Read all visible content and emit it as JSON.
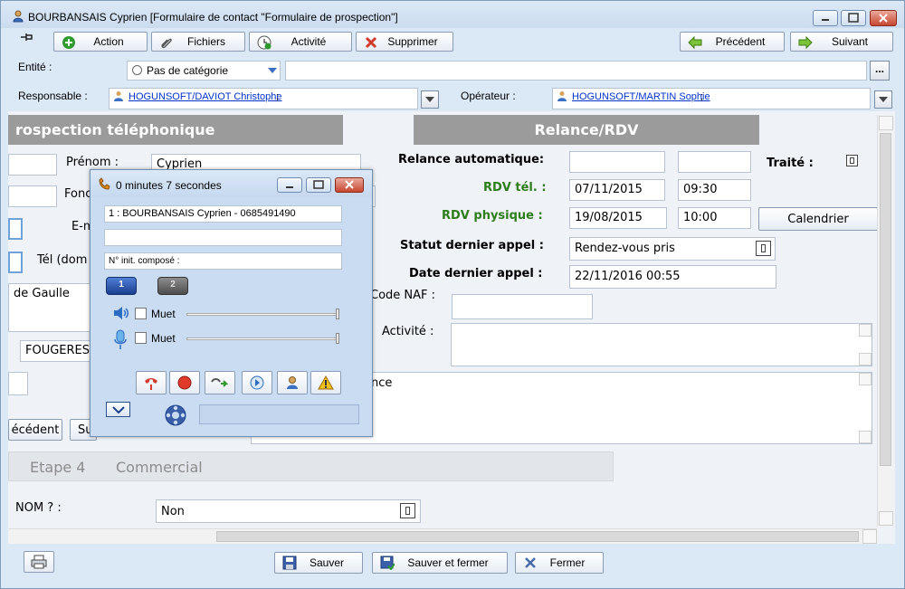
{
  "window": {
    "title": "BOURBANSAIS Cyprien [Formulaire de contact \"Formulaire de prospection\"]"
  },
  "toolbar": {
    "action": "Action",
    "fichiers": "Fichiers",
    "activite": "Activité",
    "supprimer": "Supprimer",
    "precedent": "Précédent",
    "suivant": "Suivant"
  },
  "header": {
    "entite_label": "Entité :",
    "categorie": "Pas de catégorie",
    "ellipsis": "...",
    "responsable_label": "Responsable :",
    "responsable_value": "HOGUNSOFT/DAVIOT Christophe",
    "operateur_label": "Opérateur :",
    "operateur_value": "HOGUNSOFT/MARTIN Sophie",
    "semi": ";"
  },
  "left": {
    "section_title": "rospection téléphonique",
    "prenom_label": "Prénom :",
    "prenom_value": "Cyprien",
    "fonc_label": "Fonc",
    "email_label": "E-m",
    "tel_label": "Tél (dom",
    "address_value": "de Gaulle",
    "city_value": "FOUGERES",
    "prev_btn": "écédent",
    "next_btn": "Su"
  },
  "right": {
    "section_title": "Relance/RDV",
    "relance_label": "Relance automatique:",
    "traite_label": "Traité :",
    "rdv_tel_label": "RDV tél. :",
    "rdv_tel_date": "07/11/2015",
    "rdv_tel_time": "09:30",
    "rdv_phys_label": "RDV physique  :",
    "rdv_phys_date": "19/08/2015",
    "rdv_phys_time": "10:00",
    "calendrier": "Calendrier",
    "statut_label": "Statut dernier appel :",
    "statut_value": "Rendez-vous pris",
    "date_label": "Date dernier appel :",
    "date_value": "22/11/2016 00:55",
    "naf_label": "Code NAF :",
    "activite_label": "Activité :",
    "note_fragment": "nce"
  },
  "steps": {
    "etape4": "Etape 4",
    "commercial": "Commercial"
  },
  "nom_question": {
    "label": "NOM ? :",
    "value": "Non"
  },
  "footer": {
    "sauver": "Sauver",
    "sauver_fermer": "Sauver et fermer",
    "fermer": "Fermer"
  },
  "popup": {
    "title": "0 minutes 7 secondes",
    "line1": "1 : BOURBANSAIS Cyprien - 0685491490",
    "line3": "N° init. composé :",
    "line_btn1": "1",
    "line_btn2": "2",
    "muet1": "Muet",
    "muet2": "Muet"
  },
  "colors": {
    "accent_green": "#2d7d1a",
    "section_gray": "#9b9b9b",
    "link_blue": "#0033cc"
  }
}
